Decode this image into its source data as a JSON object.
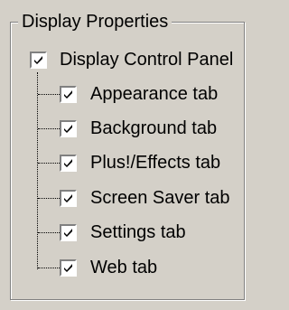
{
  "group": {
    "title": "Display Properties"
  },
  "root": {
    "label": "Display Control Panel",
    "checked": true,
    "icon": "checkbox-checked-icon"
  },
  "items": [
    {
      "label": "Appearance tab",
      "checked": true
    },
    {
      "label": "Background tab",
      "checked": true
    },
    {
      "label": "Plus!/Effects tab",
      "checked": true
    },
    {
      "label": "Screen Saver tab",
      "checked": true
    },
    {
      "label": "Settings tab",
      "checked": true
    },
    {
      "label": "Web tab",
      "checked": true
    }
  ],
  "colors": {
    "background": "#d4d0c8",
    "checkbox_fill": "#ffffff",
    "checkmark": "#000000"
  }
}
